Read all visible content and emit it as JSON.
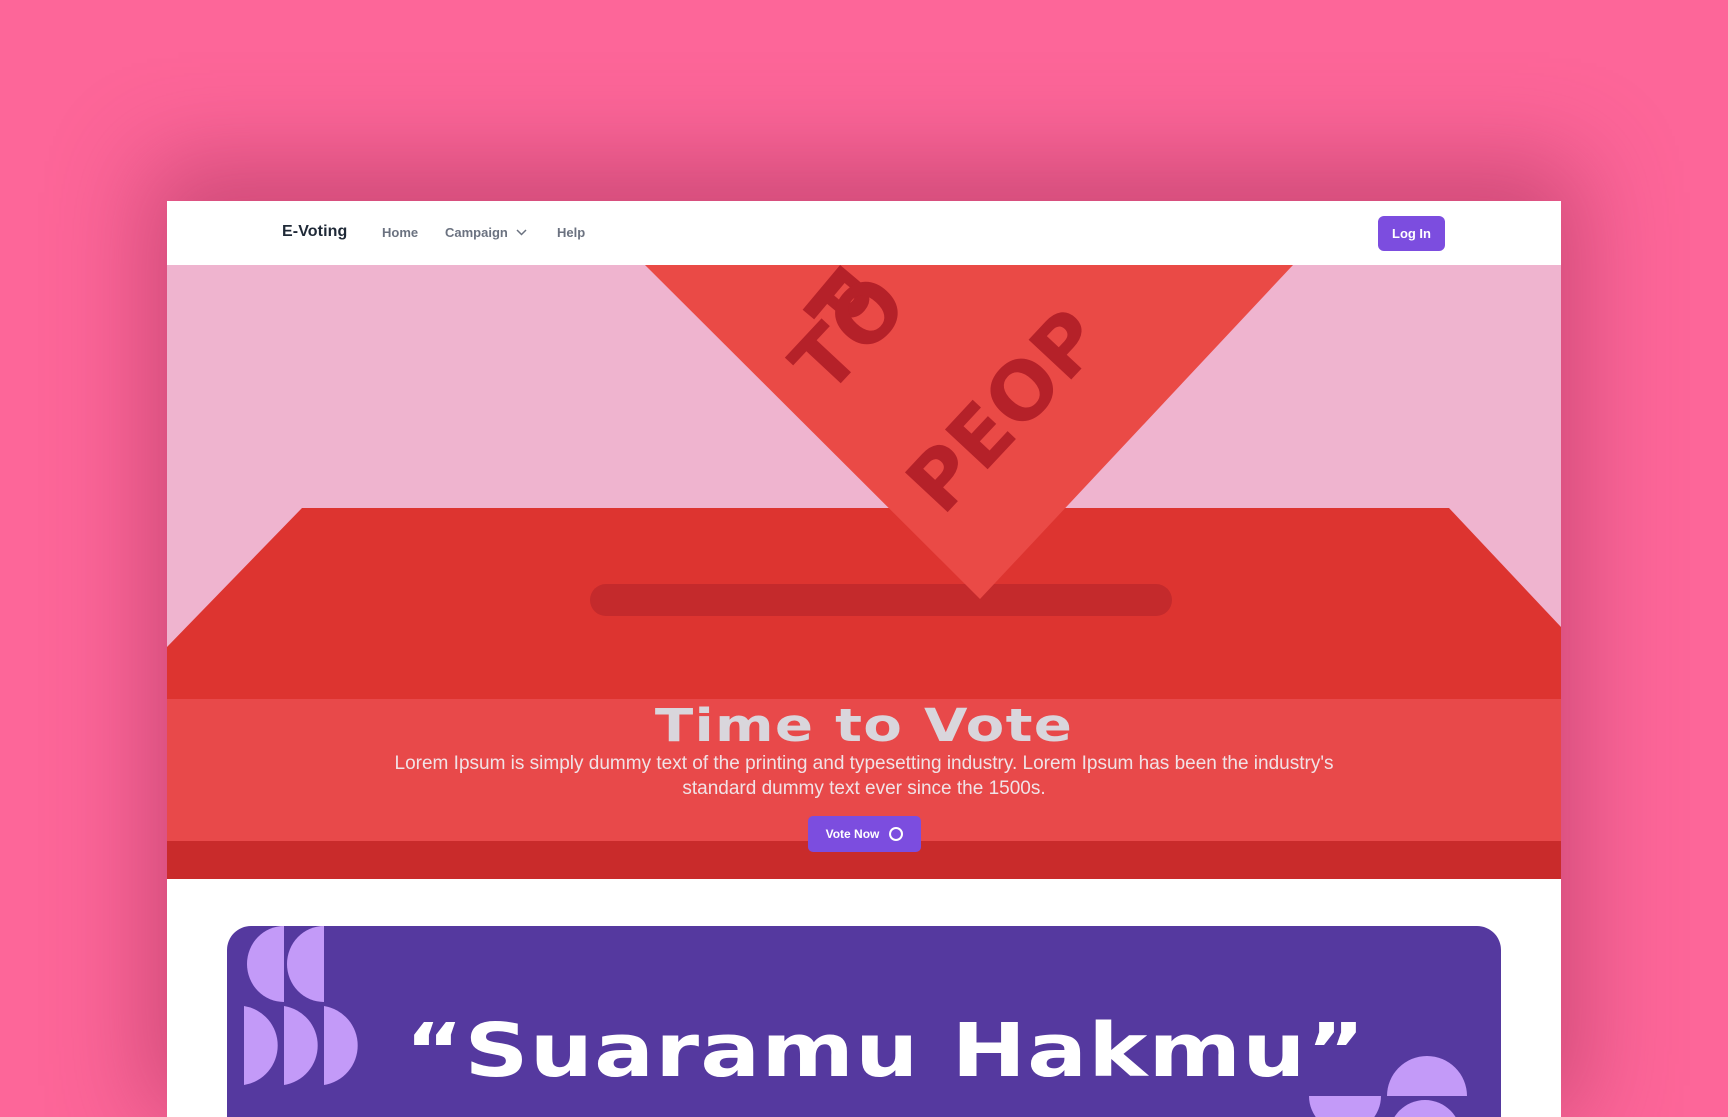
{
  "navbar": {
    "brand": "E-Voting",
    "links": [
      {
        "label": "Home"
      },
      {
        "label": "Campaign"
      },
      {
        "label": "Help"
      }
    ],
    "login_label": "Log In"
  },
  "hero": {
    "ballot_text": [
      "P",
      "TO",
      "PEOP"
    ],
    "title": "Time to Vote",
    "description": "Lorem Ipsum is simply dummy text of the printing and typesetting industry. Lorem Ipsum has been the industry's standard dummy text ever since the 1500s.",
    "cta_label": "Vote Now"
  },
  "banner": {
    "text": "“Suaramu Hakmu”"
  },
  "colors": {
    "page_background": "#fd6699",
    "accent": "#7c4ddf",
    "banner": "#55399f",
    "banner_shapes": "#c39af8",
    "hero_pink": "#efb4cf",
    "ballot_red": "#ea4a46",
    "box_red": "#dd3430"
  },
  "icons": {
    "campaign_dropdown": "chevron-down-icon",
    "vote_button": "circle-icon"
  }
}
